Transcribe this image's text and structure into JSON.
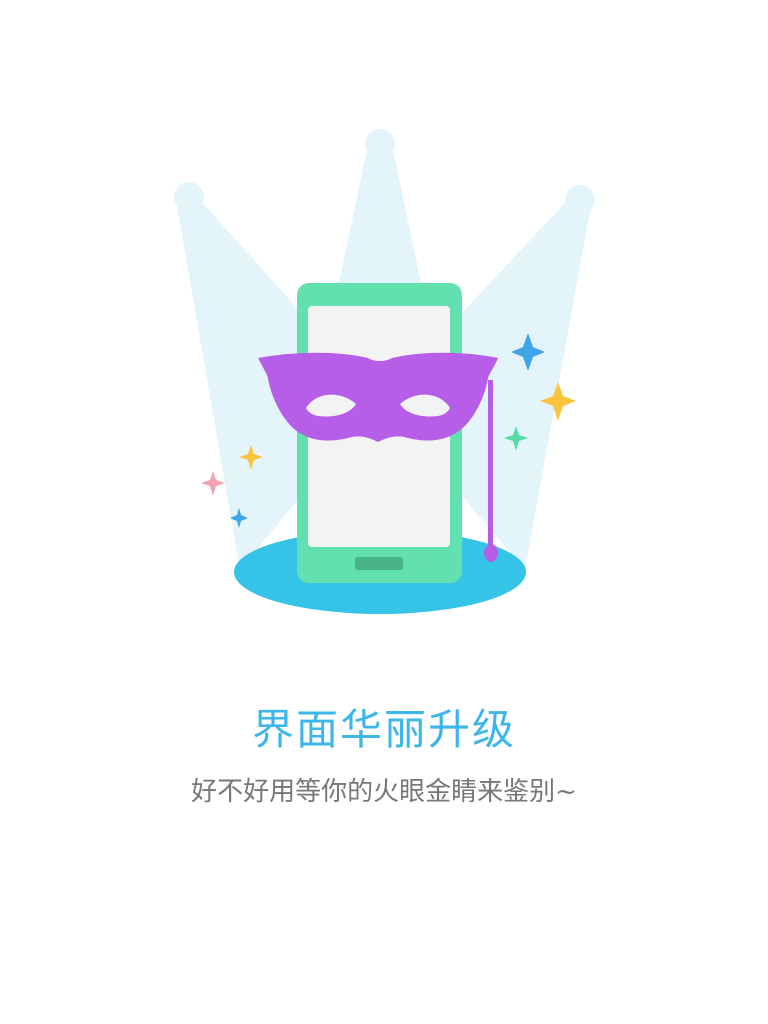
{
  "guide": {
    "title": "界面华丽升级",
    "subtitle": "好不好用等你的火眼金睛来鉴别~"
  },
  "illustration": {
    "subject": "phone-with-masquerade-mask-under-spotlights",
    "colors": {
      "spotlight": "#e4f4fb",
      "stage": "#35c3e8",
      "phone_body": "#62e0ad",
      "phone_screen": "#f3f3f3",
      "phone_button": "#48b585",
      "mask": "#b65ee8",
      "sparkle_blue": "#3fa4e8",
      "sparkle_yellow": "#fbc53d",
      "sparkle_green": "#58dba6",
      "sparkle_pink": "#f5a0b0"
    }
  },
  "theme": {
    "title_color": "#3fb6ea",
    "subtitle_color": "#777777",
    "background": "#ffffff"
  }
}
